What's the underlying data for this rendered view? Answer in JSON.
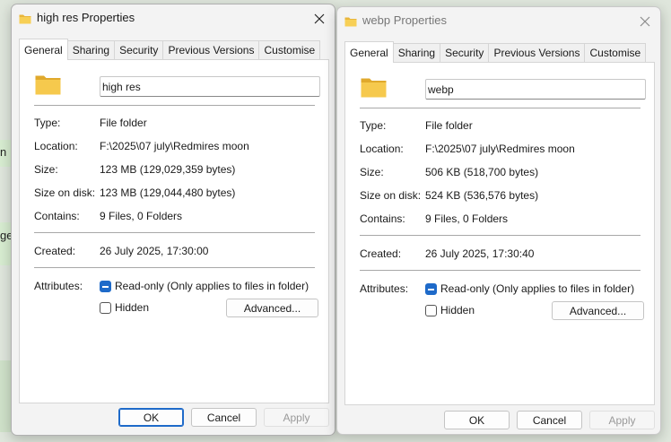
{
  "background": {
    "bubble_a_text": "n a",
    "bubble_b_text": "ge"
  },
  "colors": {
    "accent": "#1e6ac9",
    "folder": "#f4c542"
  },
  "icons": {
    "folder": "folder-icon",
    "close": "close-icon",
    "checkbox_mixed": "checkbox-indeterminate-icon"
  },
  "windows": [
    {
      "title": "high res Properties",
      "tabs": [
        "General",
        "Sharing",
        "Security",
        "Previous Versions",
        "Customise"
      ],
      "selected_tab": "General",
      "name": "high res",
      "rows": [
        {
          "label": "Type:",
          "value": "File folder"
        },
        {
          "label": "Location:",
          "value": "F:\\2025\\07 july\\Redmires moon"
        },
        {
          "label": "Size:",
          "value": "123 MB (129,029,359 bytes)"
        },
        {
          "label": "Size on disk:",
          "value": "123 MB (129,044,480 bytes)"
        },
        {
          "label": "Contains:",
          "value": "9 Files, 0 Folders"
        }
      ],
      "created_label": "Created:",
      "created_value": "26 July 2025, 17:30:00",
      "attributes_label": "Attributes:",
      "readonly_label": "Read-only (Only applies to files in folder)",
      "hidden_label": "Hidden",
      "advanced_label": "Advanced...",
      "ok_label": "OK",
      "cancel_label": "Cancel",
      "apply_label": "Apply"
    },
    {
      "title": "webp Properties",
      "tabs": [
        "General",
        "Sharing",
        "Security",
        "Previous Versions",
        "Customise"
      ],
      "selected_tab": "General",
      "name": "webp",
      "rows": [
        {
          "label": "Type:",
          "value": "File folder"
        },
        {
          "label": "Location:",
          "value": "F:\\2025\\07 july\\Redmires moon"
        },
        {
          "label": "Size:",
          "value": "506 KB (518,700 bytes)"
        },
        {
          "label": "Size on disk:",
          "value": "524 KB (536,576 bytes)"
        },
        {
          "label": "Contains:",
          "value": "9 Files, 0 Folders"
        }
      ],
      "created_label": "Created:",
      "created_value": "26 July 2025, 17:30:40",
      "attributes_label": "Attributes:",
      "readonly_label": "Read-only (Only applies to files in folder)",
      "hidden_label": "Hidden",
      "advanced_label": "Advanced...",
      "ok_label": "OK",
      "cancel_label": "Cancel",
      "apply_label": "Apply"
    }
  ]
}
